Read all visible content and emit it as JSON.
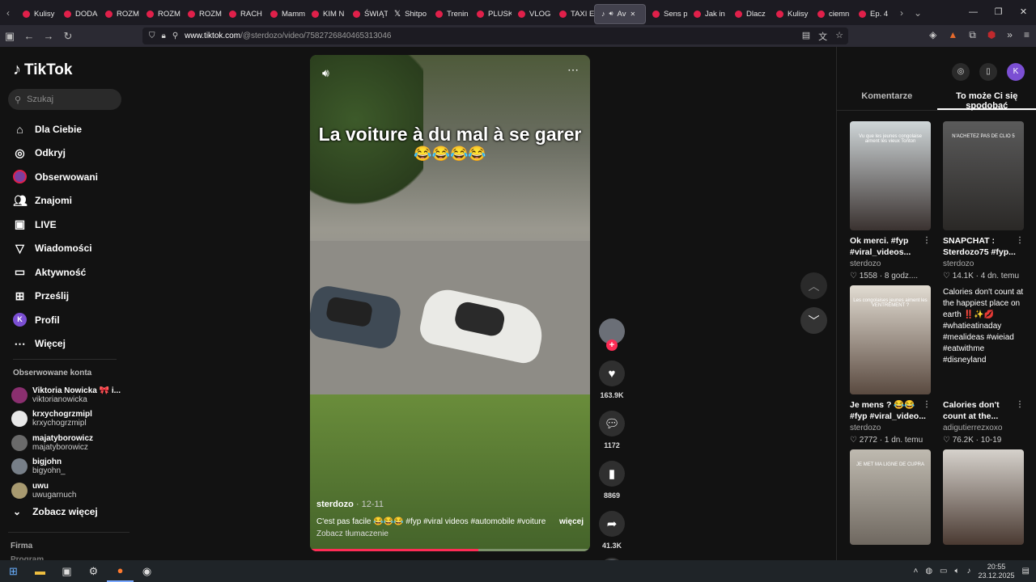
{
  "browser": {
    "tabs": [
      {
        "label": "Kulisy",
        "icon": "youtube-icon"
      },
      {
        "label": "DODA",
        "icon": "youtube-icon"
      },
      {
        "label": "ROZM",
        "icon": "youtube-icon"
      },
      {
        "label": "ROZM",
        "icon": "youtube-icon"
      },
      {
        "label": "ROZM",
        "icon": "youtube-icon"
      },
      {
        "label": "RACH",
        "icon": "youtube-icon"
      },
      {
        "label": "Mamm",
        "icon": "youtube-icon"
      },
      {
        "label": "KIM N",
        "icon": "youtube-icon"
      },
      {
        "label": "ŚWIĄT",
        "icon": "youtube-icon"
      },
      {
        "label": "Shitpo",
        "icon": "x-icon"
      },
      {
        "label": "Trenin",
        "icon": "youtube-icon"
      },
      {
        "label": "PLUSK",
        "icon": "youtube-icon"
      },
      {
        "label": "VLOG",
        "icon": "youtube-icon"
      },
      {
        "label": "TAXI E",
        "icon": "youtube-icon"
      },
      {
        "label": "Av",
        "icon": "tiktok-icon",
        "active": true
      },
      {
        "label": "Sens p",
        "icon": "youtube-icon"
      },
      {
        "label": "Jak in",
        "icon": "youtube-icon"
      },
      {
        "label": "Dlacz",
        "icon": "youtube-icon"
      },
      {
        "label": "Kulisy",
        "icon": "youtube-icon"
      },
      {
        "label": "ciemn",
        "icon": "youtube-icon"
      },
      {
        "label": "Ep. 4",
        "icon": "youtube-icon"
      }
    ],
    "url_host": "www.tiktok.com",
    "url_path": "/@sterdozo/video/7582726840465313046",
    "badge_count": "15"
  },
  "sidebar": {
    "logo": "TikTok",
    "search_placeholder": "Szukaj",
    "menu": [
      {
        "label": "Dla Ciebie",
        "icon": "home-icon"
      },
      {
        "label": "Odkryj",
        "icon": "compass-icon"
      },
      {
        "label": "Obserwowani",
        "icon": "avatar-icon"
      },
      {
        "label": "Znajomi",
        "icon": "friends-icon"
      },
      {
        "label": "LIVE",
        "icon": "live-icon"
      },
      {
        "label": "Wiadomości",
        "icon": "send-icon"
      },
      {
        "label": "Aktywność",
        "icon": "inbox-icon"
      },
      {
        "label": "Prześlij",
        "icon": "upload-icon"
      },
      {
        "label": "Profil",
        "icon": "profile-icon"
      },
      {
        "label": "Więcej",
        "icon": "more-icon"
      }
    ],
    "followed_title": "Obserwowane konta",
    "followed": [
      {
        "name": "Viktoria Nowicka 🎀 i...",
        "handle": "viktorianowicka"
      },
      {
        "name": "krxychogrzmipl",
        "handle": "krxychogrzmipl"
      },
      {
        "name": "majatyborowicz",
        "handle": "majatyborowicz"
      },
      {
        "name": "bigjohn",
        "handle": "bigyohn_"
      },
      {
        "name": "uwu",
        "handle": "uwugarnuch"
      }
    ],
    "see_more": "Zobacz więcej",
    "footer_1": "Firma",
    "footer_2": "Program"
  },
  "video": {
    "overlay_title": "La voiture à du mal à se garer",
    "overlay_emoji": "😂😂😂😂",
    "author": "sterdozo",
    "date": "· 12-11",
    "description": "C'est pas facile 😂😂😂 #fyp #viral videos #automobile #voiture",
    "more_label": "więcej",
    "translate_label": "Zobacz tłumaczenie",
    "progress": 0.6
  },
  "actions": {
    "likes": "163.9K",
    "comments": "1172",
    "saves": "8869",
    "shares": "41.3K"
  },
  "right_panel": {
    "tabs": [
      "Komentarze",
      "To może Ci się spodobać"
    ],
    "active_tab": 1,
    "avatar_letter": "K",
    "cards": [
      {
        "thumb_text": "Vu que les jeunes congolaise aiment les vieux Tonton",
        "title": "Ok merci. #fyp #viral_videos...",
        "author": "sterdozo",
        "likes": "1558",
        "age": "8 godz...."
      },
      {
        "thumb_text": "N'ACHETEZ PAS DE CLIO 5",
        "title": "SNAPCHAT : Sterdozo75 #fyp...",
        "author": "sterdozo",
        "likes": "14.1K",
        "age": "4 dn. temu"
      },
      {
        "thumb_text": "Les congolaises jeunes aiment les VENTREMENT ?",
        "title": "Je mens ? 😂😂 #fyp #viral_video...",
        "author": "sterdozo",
        "likes": "2772",
        "age": "1 dn. temu"
      },
      {
        "thumb_text": "Calories don't count at the happiest place on earth ‼️✨💋 #whatieatinaday #mealideas #wieiad #eatwithme #disneyland",
        "title": "Calories don't count at the...",
        "author": "adigutierrezxoxo",
        "likes": "76.2K",
        "age": "10-19"
      },
      {
        "thumb_text": "JE MET MA LIGNE DE CUPRA",
        "title": "",
        "author": "",
        "likes": "",
        "age": ""
      },
      {
        "thumb_text": "",
        "title": "",
        "author": "",
        "likes": "",
        "age": ""
      }
    ]
  },
  "taskbar": {
    "time": "20:55",
    "date": "23.12.2025"
  },
  "colors": {
    "accent": "#fe2c55",
    "background": "#121212"
  }
}
